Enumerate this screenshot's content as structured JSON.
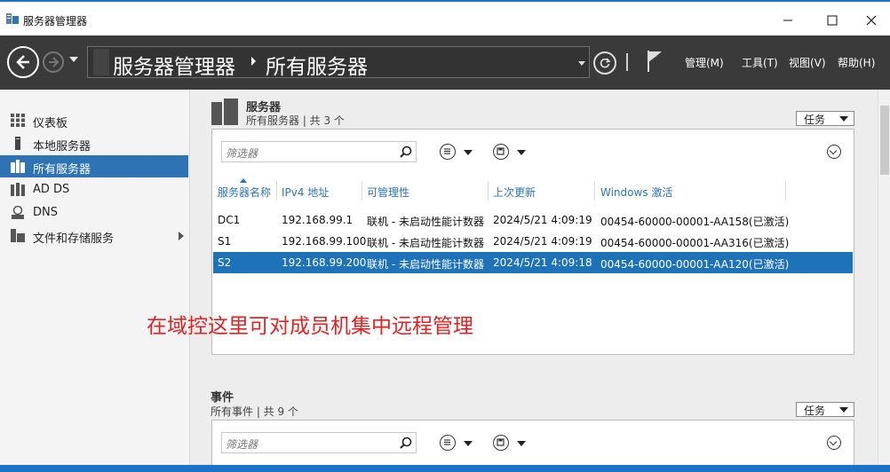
{
  "window": {
    "title": "服务器管理器",
    "min_icon": "minimize-icon",
    "max_icon": "maximize-icon",
    "close_icon": "close-icon"
  },
  "navbar": {
    "breadcrumb_root": "服务器管理器",
    "breadcrumb_current": "所有服务器",
    "menus": [
      "管理(M)",
      "工具(T)",
      "视图(V)",
      "帮助(H)"
    ]
  },
  "sidebar": {
    "items": [
      {
        "label": "仪表板",
        "icon": "dashboard-icon"
      },
      {
        "label": "本地服务器",
        "icon": "local-server-icon"
      },
      {
        "label": "所有服务器",
        "icon": "all-servers-icon",
        "active": true
      },
      {
        "label": "AD DS",
        "icon": "ad-ds-icon"
      },
      {
        "label": "DNS",
        "icon": "dns-icon"
      },
      {
        "label": "文件和存储服务",
        "icon": "file-storage-icon",
        "has_arrow": true
      }
    ]
  },
  "servers_section": {
    "title": "服务器",
    "subtitle": "所有服务器 | 共 3 个",
    "tasks_label": "任务",
    "filter_placeholder": "筛选器",
    "columns": [
      "服务器名称",
      "IPv4 地址",
      "可管理性",
      "上次更新",
      "Windows 激活"
    ],
    "rows": [
      {
        "name": "DC1",
        "ip": "192.168.99.1",
        "manageability": "联机 - 未启动性能计数器",
        "last_update": "2024/5/21 4:09:19",
        "activation": "00454-60000-00001-AA158(已激活)"
      },
      {
        "name": "S1",
        "ip": "192.168.99.100",
        "manageability": "联机 - 未启动性能计数器",
        "last_update": "2024/5/21 4:09:19",
        "activation": "00454-60000-00001-AA316(已激活)"
      },
      {
        "name": "S2",
        "ip": "192.168.99.200",
        "manageability": "联机 - 未启动性能计数器",
        "last_update": "2024/5/21 4:09:18",
        "activation": "00454-60000-00001-AA120(已激活)",
        "selected": true
      }
    ]
  },
  "annotation": "在域控这里可对成员机集中远程管理",
  "events_section": {
    "title": "事件",
    "subtitle": "所有事件 | 共 9 个",
    "tasks_label": "任务",
    "filter_placeholder": "筛选器"
  },
  "colors": {
    "accent": "#2e74b5",
    "selected_row": "#1e72b8",
    "navbar": "#3a3a3a",
    "annotation": "#e02323"
  }
}
